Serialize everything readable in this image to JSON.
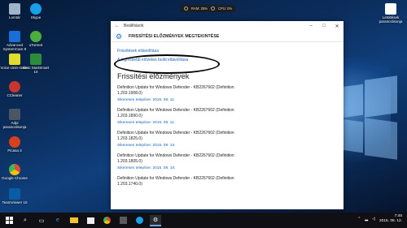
{
  "desktop": {
    "icons": [
      {
        "label": "Lomtár",
        "color": "#9fb6c9"
      },
      {
        "label": "Skype",
        "color": "#18a0e8"
      },
      {
        "label": "Advanced SystemCare 8",
        "color": "#1a6fd6"
      },
      {
        "label": "uTorrent",
        "color": "#4cae3c"
      },
      {
        "label": "Voice Unin-staller",
        "color": "#e2dc2c"
      },
      {
        "label": "Nero StartSmart 10",
        "color": "#2c8c3c"
      },
      {
        "label": "CCleaner",
        "color": "#c8352c"
      },
      {
        "label": "Adpi parancslisonja",
        "color": "#4b5563"
      },
      {
        "label": "Picasa 3",
        "color": "#d8401c"
      },
      {
        "label": "Google Chrome",
        "color": "#dd4b39"
      },
      {
        "label": "TeamViewer 10",
        "color": "#0b5ca8"
      },
      {
        "label": "Letöltések parancslisonja",
        "color": "#ffffff"
      }
    ]
  },
  "sysbar": {
    "ram": "RAM: 28%",
    "cpu": "CPU: 0%"
  },
  "window": {
    "title": "Beállítások",
    "header": "FRISSÍTÉSI ELŐZMÉNYEK MEGTEKINTÉSE",
    "link_uninstall": "Frissítések eltávolítása",
    "link_rollback": "A legfrissebb előzetes build eltávolítása",
    "section_title": "Frissítési előzmények",
    "updates": [
      {
        "name": "Definition Update for Windows Defender - KB2267602 (Definition 1.203.1908.0)",
        "status": "Sikeresen telepítve: 2015. 08. 11."
      },
      {
        "name": "Definition Update for Windows Defender - KB2267602 (Definition 1.203.1890.0)",
        "status": "Sikeresen telepítve: 2015. 08. 11."
      },
      {
        "name": "Definition Update for Windows Defender - KB2267602 (Definition 1.203.1825.0)",
        "status": "Sikeresen telepítve: 2015. 08. 10."
      },
      {
        "name": "Definition Update for Windows Defender - KB2267602 (Definition 1.203.1805.0)",
        "status": "Sikeresen telepítve: 2015. 08. 10."
      },
      {
        "name": "Definition Update for Windows Defender - KB2267602 (Definition 1.203.1740.0)",
        "status": ""
      }
    ]
  },
  "taskbar": {
    "time": "7:45",
    "date": "2015. 08. 12."
  }
}
